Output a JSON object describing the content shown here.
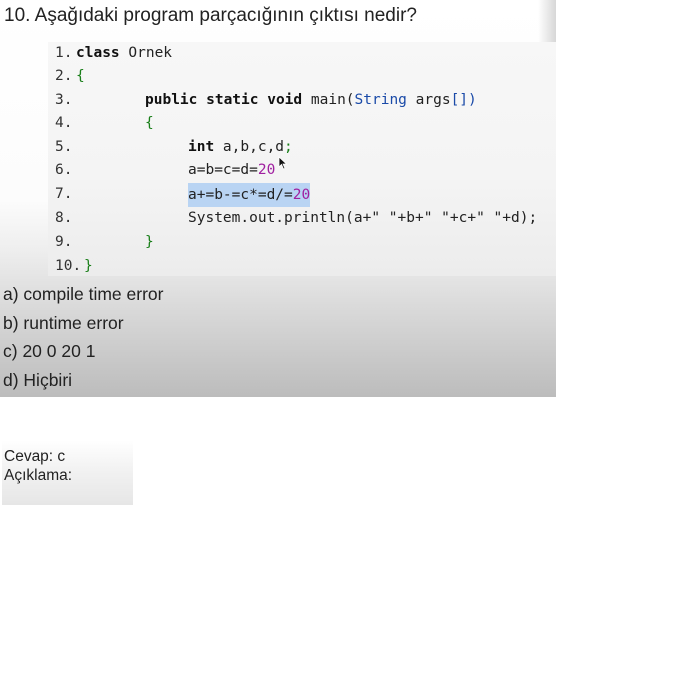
{
  "question": {
    "number": "10.",
    "text": "Aşağıdaki program parçacığının çıktısı nedir?"
  },
  "code": {
    "lines": [
      {
        "num": "1.",
        "parts": [
          {
            "t": "class ",
            "c": "kw"
          },
          {
            "t": "Ornek",
            "c": ""
          }
        ]
      },
      {
        "num": "2.",
        "parts": [
          {
            "t": "{",
            "c": "brace"
          }
        ]
      },
      {
        "num": "3.",
        "parts": [
          {
            "t": "public static void ",
            "c": "kw"
          },
          {
            "t": "main(",
            "c": ""
          },
          {
            "t": "String",
            "c": "blue"
          },
          {
            "t": " args",
            "c": ""
          },
          {
            "t": "[])",
            "c": "blue"
          }
        ]
      },
      {
        "num": "4.",
        "parts": [
          {
            "t": "{",
            "c": "brace"
          }
        ]
      },
      {
        "num": "5.",
        "parts": [
          {
            "t": "int ",
            "c": "kw"
          },
          {
            "t": "a,b,c,d",
            "c": ""
          },
          {
            "t": ";",
            "c": "brace"
          }
        ]
      },
      {
        "num": "6.",
        "parts": [
          {
            "t": "a=b=c=d=",
            "c": ""
          },
          {
            "t": "20",
            "c": "num"
          }
        ]
      },
      {
        "num": "7.",
        "parts": [
          {
            "t": "a+=b-=c*=d/=",
            "c": ""
          },
          {
            "t": "20",
            "c": "num"
          }
        ]
      },
      {
        "num": "8.",
        "parts": [
          {
            "t": "System.out.println(a+\" \"+b+\" \"+c+\" \"+d);",
            "c": ""
          }
        ]
      },
      {
        "num": "9.",
        "parts": [
          {
            "t": "}",
            "c": "brace"
          }
        ]
      },
      {
        "num": "10.",
        "parts": [
          {
            "t": "}",
            "c": "brace"
          }
        ]
      }
    ]
  },
  "options": [
    "a) compile time error",
    "b) runtime error",
    "c) 20 0 20 1",
    "d) Hiçbiri"
  ],
  "answer": {
    "label": "Cevap: c",
    "explanation_label": "Açıklama:"
  },
  "colors": {
    "keyword": "#111111",
    "number": "#a020a0",
    "brace": "#1a7f1a",
    "type": "#1a4aa8",
    "highlight": "#b9d4f3"
  }
}
